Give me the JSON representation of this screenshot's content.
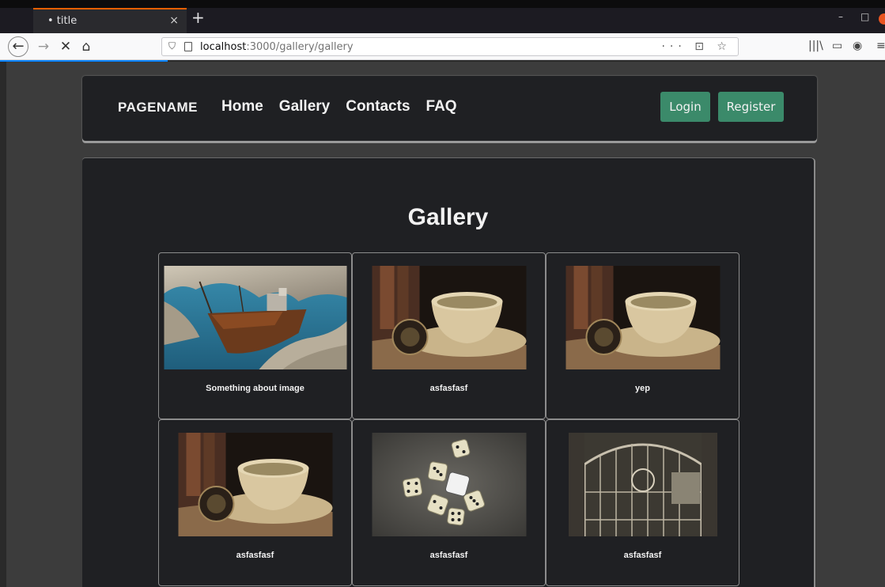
{
  "browser": {
    "tab_title": "• title",
    "tab_close": "×",
    "new_tab": "+",
    "url_host": "localhost",
    "url_path": ":3000/gallery/gallery",
    "url_actions": "··· ⊡ ☆",
    "icons": [
      "back-arrow-icon",
      "forward-arrow-icon",
      "stop-icon",
      "home-icon",
      "shield-icon",
      "page-icon",
      "pocket-icon",
      "bookmark-star-icon",
      "library-icon",
      "sidebar-icon",
      "account-icon",
      "menu-icon"
    ]
  },
  "header": {
    "brand": "PAGENAME",
    "menu": [
      "Home",
      "Gallery",
      "Contacts",
      "FAQ"
    ],
    "login": "Login",
    "register": "Register"
  },
  "main": {
    "title": "Gallery",
    "cards": [
      {
        "caption": "Something about image",
        "image": "shipwreck"
      },
      {
        "caption": "asfasfasf",
        "image": "teacup"
      },
      {
        "caption": "yep",
        "image": "teacup"
      },
      {
        "caption": "asfasfasf",
        "image": "teacup"
      },
      {
        "caption": "asfasfasf",
        "image": "dice"
      },
      {
        "caption": "asfasfasf",
        "image": "gate"
      }
    ]
  },
  "colors": {
    "accent_button": "#3b8a6a",
    "panel": "#1f2023",
    "page_bg": "#3c3c3c",
    "tab_accent": "#e66000"
  }
}
